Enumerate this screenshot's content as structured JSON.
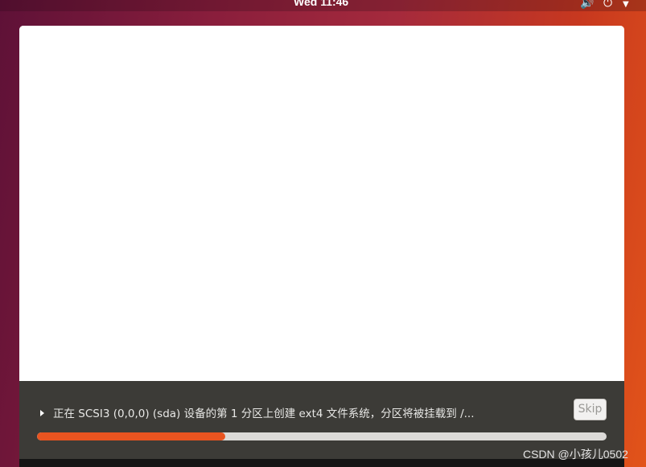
{
  "topbar": {
    "clock": "Wed 11:46",
    "icons": [
      "speaker-icon",
      "power-icon",
      "chevron-down-icon"
    ]
  },
  "installer": {
    "status_text": "正在 SCSI3 (0,0,0) (sda) 设备的第 1 分区上创建 ext4 文件系统，分区将被挂载到 /...",
    "skip_label": "Skip",
    "progress_fraction": 0.33,
    "colors": {
      "progress_fill": "#e95420",
      "progress_track": "#dcdad7",
      "footer_bg": "#3c3b37"
    }
  },
  "watermark": "CSDN @小孩儿0502"
}
